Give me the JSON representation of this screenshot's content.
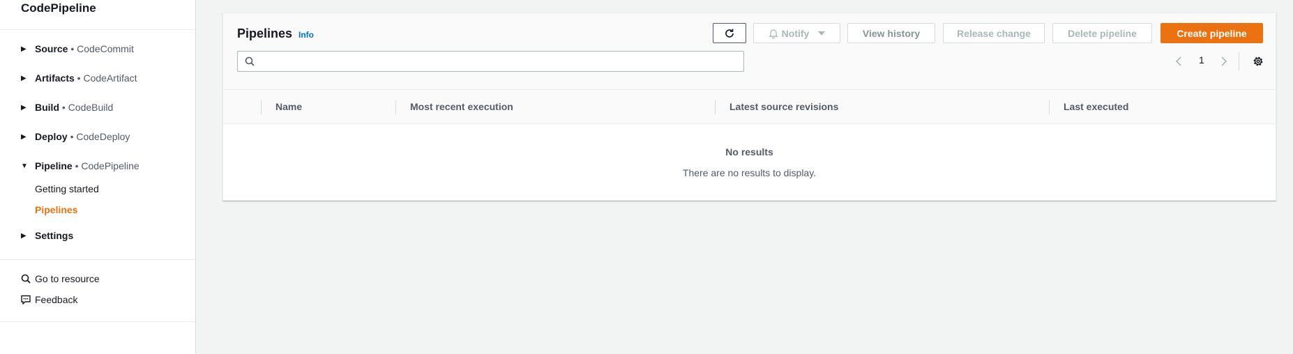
{
  "sidebar": {
    "title": "CodePipeline",
    "sections": [
      {
        "name": "Source",
        "sep": " • ",
        "service": "CodeCommit",
        "expanded": false
      },
      {
        "name": "Artifacts",
        "sep": " • ",
        "service": "CodeArtifact",
        "expanded": false
      },
      {
        "name": "Build",
        "sep": " • ",
        "service": "CodeBuild",
        "expanded": false
      },
      {
        "name": "Deploy",
        "sep": " • ",
        "service": "CodeDeploy",
        "expanded": false
      },
      {
        "name": "Pipeline",
        "sep": " • ",
        "service": "CodePipeline",
        "expanded": true
      }
    ],
    "pipeline_children": [
      {
        "label": "Getting started"
      },
      {
        "label": "Pipelines",
        "active": true
      }
    ],
    "settings": "Settings",
    "go_to_resource": "Go to resource",
    "feedback": "Feedback"
  },
  "panel": {
    "title": "Pipelines",
    "info": "Info",
    "buttons": {
      "notify": "Notify",
      "view_history": "View history",
      "release_change": "Release change",
      "delete_pipeline": "Delete pipeline",
      "create_pipeline": "Create pipeline"
    },
    "search": {
      "value": "",
      "placeholder": ""
    },
    "pagination": {
      "current_page": "1"
    },
    "columns": [
      "Name",
      "Most recent execution",
      "Latest source revisions",
      "Last executed"
    ],
    "empty": {
      "title": "No results",
      "message": "There are no results to display."
    }
  },
  "colors": {
    "accent": "#ec7211",
    "link": "#0073bb",
    "text": "#16191f",
    "muted": "#545b64",
    "disabled": "#aab7b8",
    "background": "#f2f3f3"
  }
}
